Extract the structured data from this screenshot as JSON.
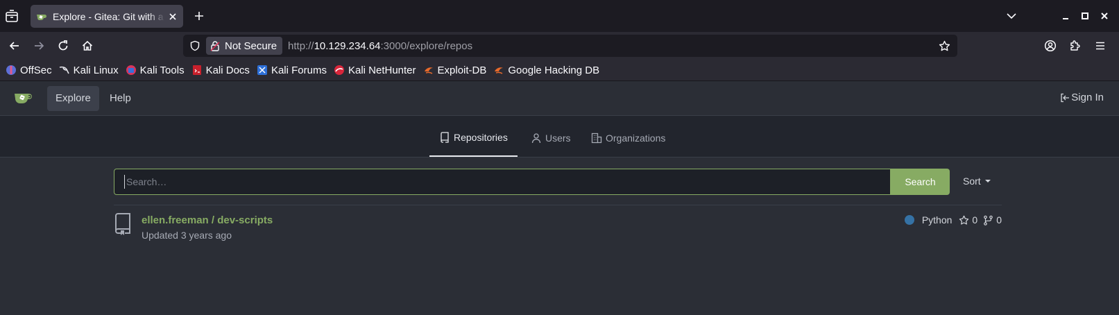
{
  "browser": {
    "tab_title": "Explore - Gitea: Git with a cup of tea",
    "security_label": "Not Secure",
    "url_prefix": "http://",
    "url_host": "10.129.234.64",
    "url_rest": ":3000/explore/repos",
    "bookmarks": [
      {
        "label": "OffSec",
        "icon": "offsec-icon"
      },
      {
        "label": "Kali Linux",
        "icon": "kali-dragon-icon"
      },
      {
        "label": "Kali Tools",
        "icon": "kali-tools-icon"
      },
      {
        "label": "Kali Docs",
        "icon": "kali-docs-icon"
      },
      {
        "label": "Kali Forums",
        "icon": "kali-forums-icon"
      },
      {
        "label": "Kali NetHunter",
        "icon": "nethunter-icon"
      },
      {
        "label": "Exploit-DB",
        "icon": "exploit-db-icon"
      },
      {
        "label": "Google Hacking DB",
        "icon": "ghdb-icon"
      }
    ]
  },
  "gitea": {
    "nav": {
      "explore": "Explore",
      "help": "Help",
      "sign_in": "Sign In"
    },
    "tabs": [
      {
        "label": "Repositories",
        "icon": "repo-icon",
        "active": true
      },
      {
        "label": "Users",
        "icon": "person-icon",
        "active": false
      },
      {
        "label": "Organizations",
        "icon": "organization-icon",
        "active": false
      }
    ],
    "search": {
      "placeholder": "Search…",
      "value": "",
      "button": "Search",
      "sort": "Sort"
    },
    "repos": [
      {
        "name": "ellen.freeman / dev-scripts",
        "updated": "Updated 3 years ago",
        "language": "Python",
        "language_color": "#3572A5",
        "stars": "0",
        "forks": "0"
      }
    ]
  },
  "colors": {
    "accent": "#87ab63",
    "page_bg": "#2b2e36",
    "browser_bg": "#1c1b22"
  }
}
